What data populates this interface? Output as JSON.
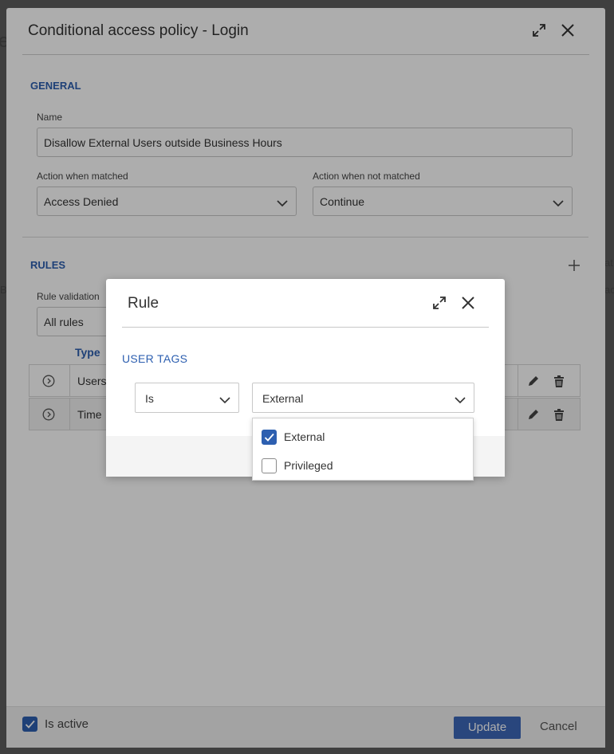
{
  "background": {
    "left_fragment_1": "e",
    "left_fragment_2": "B",
    "right_fragment_1": "at",
    "right_fragment_2": "ac"
  },
  "policy_modal": {
    "title": "Conditional access policy - Login",
    "general_section": "GENERAL",
    "name_label": "Name",
    "name_value": "Disallow External Users outside Business Hours",
    "action_matched_label": "Action when matched",
    "action_matched_value": "Access Denied",
    "action_not_matched_label": "Action when not matched",
    "action_not_matched_value": "Continue",
    "rules_section": "RULES",
    "rule_validation_label": "Rule validation",
    "rule_validation_value": "All rules",
    "table_header_type": "Type",
    "rows": [
      {
        "type": "Users"
      },
      {
        "type": "Time"
      }
    ],
    "is_active_label": "Is active",
    "update_label": "Update",
    "cancel_label": "Cancel"
  },
  "rule_modal": {
    "title": "Rule",
    "user_tags_label": "USER TAGS",
    "operator_value": "Is",
    "tag_value": "External",
    "options": [
      {
        "label": "External",
        "checked": true
      },
      {
        "label": "Privileged",
        "checked": false
      }
    ]
  },
  "colors": {
    "accent": "#2d5fb0",
    "primary_button": "#3d68b8"
  }
}
